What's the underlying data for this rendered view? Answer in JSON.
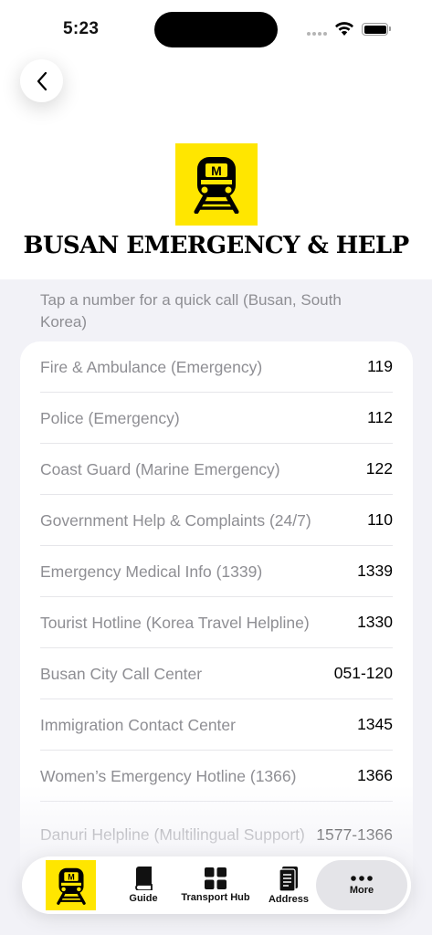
{
  "status_bar": {
    "time": "5:23"
  },
  "header": {
    "logo_icon": "metro-train-icon",
    "logo_letter": "M",
    "title": "BUSAN EMERGENCY & HELP",
    "brand_color": "#ffe600"
  },
  "subtitle": "Tap a number for a quick call (Busan, South Korea)",
  "contacts": [
    {
      "label": "Fire & Ambulance (Emergency)",
      "number": "119"
    },
    {
      "label": "Police (Emergency)",
      "number": "112"
    },
    {
      "label": "Coast Guard (Marine Emergency)",
      "number": "122"
    },
    {
      "label": "Government Help & Complaints (24/7)",
      "number": "110"
    },
    {
      "label": "Emergency Medical Info (1339)",
      "number": "1339"
    },
    {
      "label": "Tourist Hotline (Korea Travel Helpline)",
      "number": "1330"
    },
    {
      "label": "Busan City Call Center",
      "number": "051-120"
    },
    {
      "label": "Immigration Contact Center",
      "number": "1345"
    },
    {
      "label": "Women’s Emergency Hotline (1366)",
      "number": "1366"
    },
    {
      "label": "Danuri Helpline (Multilingual Support)",
      "number": "1577-1366"
    }
  ],
  "tabbar": {
    "items": [
      {
        "label": "",
        "icon": "metro-train-icon"
      },
      {
        "label": "Guide",
        "icon": "book-icon"
      },
      {
        "label": "Transport Hub",
        "icon": "grid-icon"
      },
      {
        "label": "Address",
        "icon": "notebook-icon"
      },
      {
        "label": "More",
        "icon": "more-dots-icon"
      }
    ]
  }
}
